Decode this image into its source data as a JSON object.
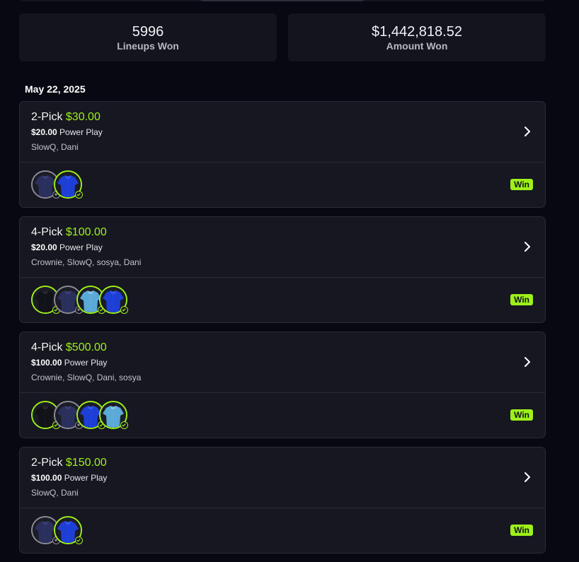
{
  "stats": {
    "lineups_won": {
      "value": "5996",
      "label": "Lineups Won"
    },
    "amount_won": {
      "value": "$1,442,818.52",
      "label": "Amount Won"
    }
  },
  "date": "May 22, 2025",
  "colors": {
    "accent": "#9ef01a",
    "card_bg": "#161720",
    "page_bg": "#070812",
    "pending_ring": "#8b8c96"
  },
  "icons": {
    "chevron": "chevron-right-icon",
    "check": "check-icon",
    "pending": "pending-dot-icon"
  },
  "cards": [
    {
      "pick": "2-Pick",
      "payout": "$30.00",
      "entry": "$20.00",
      "mode": "Power Play",
      "players": "SlowQ, Dani",
      "result": "Win",
      "avatars": [
        {
          "jersey": "navy",
          "status": "pending"
        },
        {
          "jersey": "blue",
          "status": "won"
        }
      ]
    },
    {
      "pick": "4-Pick",
      "payout": "$100.00",
      "entry": "$20.00",
      "mode": "Power Play",
      "players": "Crownie, SlowQ, sosya, Dani",
      "result": "Win",
      "avatars": [
        {
          "jersey": "black",
          "status": "won"
        },
        {
          "jersey": "navy",
          "status": "pending"
        },
        {
          "jersey": "lightblue",
          "status": "won"
        },
        {
          "jersey": "blue",
          "status": "won"
        }
      ]
    },
    {
      "pick": "4-Pick",
      "payout": "$500.00",
      "entry": "$100.00",
      "mode": "Power Play",
      "players": "Crownie, SlowQ, Dani, sosya",
      "result": "Win",
      "avatars": [
        {
          "jersey": "black",
          "status": "won"
        },
        {
          "jersey": "navy",
          "status": "pending"
        },
        {
          "jersey": "blue",
          "status": "won"
        },
        {
          "jersey": "lightblue",
          "status": "won"
        }
      ]
    },
    {
      "pick": "2-Pick",
      "payout": "$150.00",
      "entry": "$100.00",
      "mode": "Power Play",
      "players": "SlowQ, Dani",
      "result": "Win",
      "avatars": [
        {
          "jersey": "navy",
          "status": "pending"
        },
        {
          "jersey": "blue",
          "status": "won"
        }
      ]
    }
  ]
}
